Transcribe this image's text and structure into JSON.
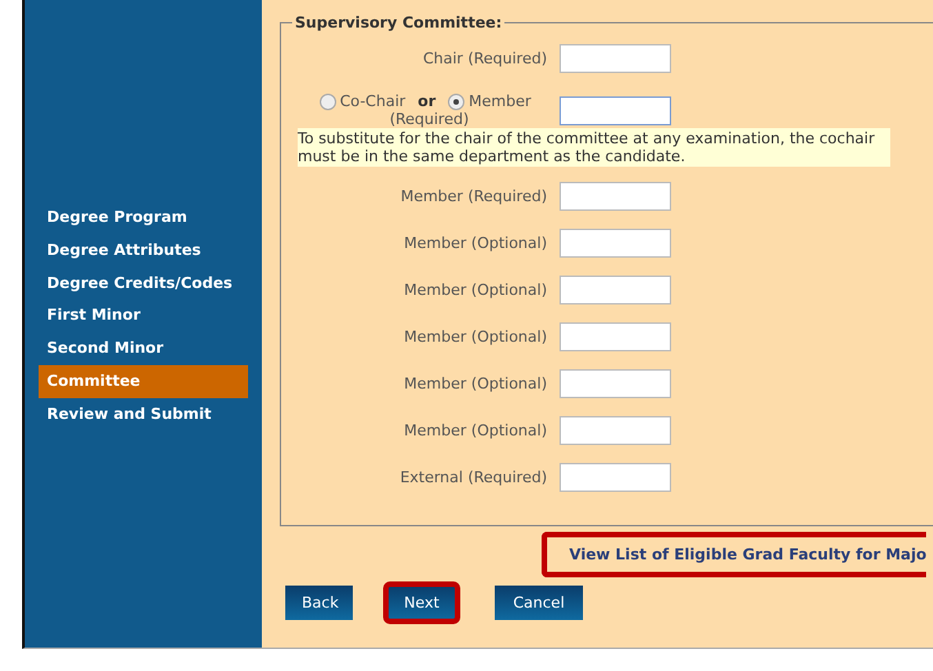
{
  "sidebar": {
    "items": [
      {
        "label": "Degree Program",
        "selected": false
      },
      {
        "label": "Degree Attributes",
        "selected": false
      },
      {
        "label": "Degree Credits/Codes",
        "selected": false
      },
      {
        "label": "First Minor",
        "selected": false
      },
      {
        "label": "Second Minor",
        "selected": false
      },
      {
        "label": "Committee",
        "selected": true
      },
      {
        "label": "Review and Submit",
        "selected": false
      }
    ]
  },
  "fieldset": {
    "legend": "Supervisory Committee:",
    "rows": [
      {
        "kind": "text",
        "label": "Chair (Required)"
      },
      {
        "kind": "choice",
        "options": [
          {
            "label": "Co-Chair",
            "selected": false
          },
          {
            "label": "Member",
            "selected": true
          }
        ],
        "joiner": "or",
        "label": "(Required)",
        "note": "To substitute for the chair of the committee at any examination, the cochair must be in the same department as the candidate."
      },
      {
        "kind": "text",
        "label": "Member (Required)"
      },
      {
        "kind": "text",
        "label": "Member (Optional)"
      },
      {
        "kind": "text",
        "label": "Member (Optional)"
      },
      {
        "kind": "text",
        "label": "Member (Optional)"
      },
      {
        "kind": "text",
        "label": "Member (Optional)"
      },
      {
        "kind": "text",
        "label": "Member (Optional)"
      },
      {
        "kind": "text",
        "label": "External (Required)"
      }
    ]
  },
  "link": {
    "label": "View List of Eligible Grad Faculty for Majo",
    "highlighted": true
  },
  "buttons": [
    {
      "label": "Back",
      "highlighted": false
    },
    {
      "label": "Next",
      "highlighted": true
    },
    {
      "label": "Cancel",
      "highlighted": false
    }
  ]
}
